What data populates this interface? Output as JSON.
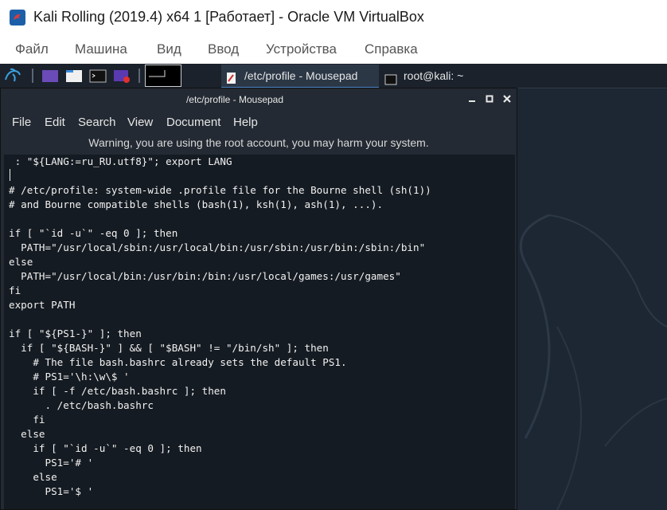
{
  "vbox": {
    "title": "Kali Rolling (2019.4) x64 1 [Работает] - Oracle VM VirtualBox",
    "menu": [
      "Файл",
      "Машина",
      "Вид",
      "Ввод",
      "Устройства",
      "Справка"
    ]
  },
  "taskbar": {
    "tasks": [
      {
        "label": "/etc/profile - Mousepad",
        "icon": "document-icon",
        "active": true
      },
      {
        "label": "root@kali: ~",
        "icon": "terminal-icon",
        "active": false
      }
    ]
  },
  "mousepad": {
    "title": "/etc/profile - Mousepad",
    "menu": [
      "File",
      "Edit",
      "Search",
      "View",
      "Document",
      "Help"
    ],
    "warning": "Warning, you are using the root account, you may harm your system.",
    "lines": [
      " : \"${LANG:=ru_RU.utf8}\"; export LANG",
      "",
      "# /etc/profile: system-wide .profile file for the Bourne shell (sh(1))",
      "# and Bourne compatible shells (bash(1), ksh(1), ash(1), ...).",
      "",
      "if [ \"`id -u`\" -eq 0 ]; then",
      "  PATH=\"/usr/local/sbin:/usr/local/bin:/usr/sbin:/usr/bin:/sbin:/bin\"",
      "else",
      "  PATH=\"/usr/local/bin:/usr/bin:/bin:/usr/local/games:/usr/games\"",
      "fi",
      "export PATH",
      "",
      "if [ \"${PS1-}\" ]; then",
      "  if [ \"${BASH-}\" ] && [ \"$BASH\" != \"/bin/sh\" ]; then",
      "    # The file bash.bashrc already sets the default PS1.",
      "    # PS1='\\h:\\w\\$ '",
      "    if [ -f /etc/bash.bashrc ]; then",
      "      . /etc/bash.bashrc",
      "    fi",
      "  else",
      "    if [ \"`id -u`\" -eq 0 ]; then",
      "      PS1='# '",
      "    else",
      "      PS1='$ '"
    ]
  }
}
